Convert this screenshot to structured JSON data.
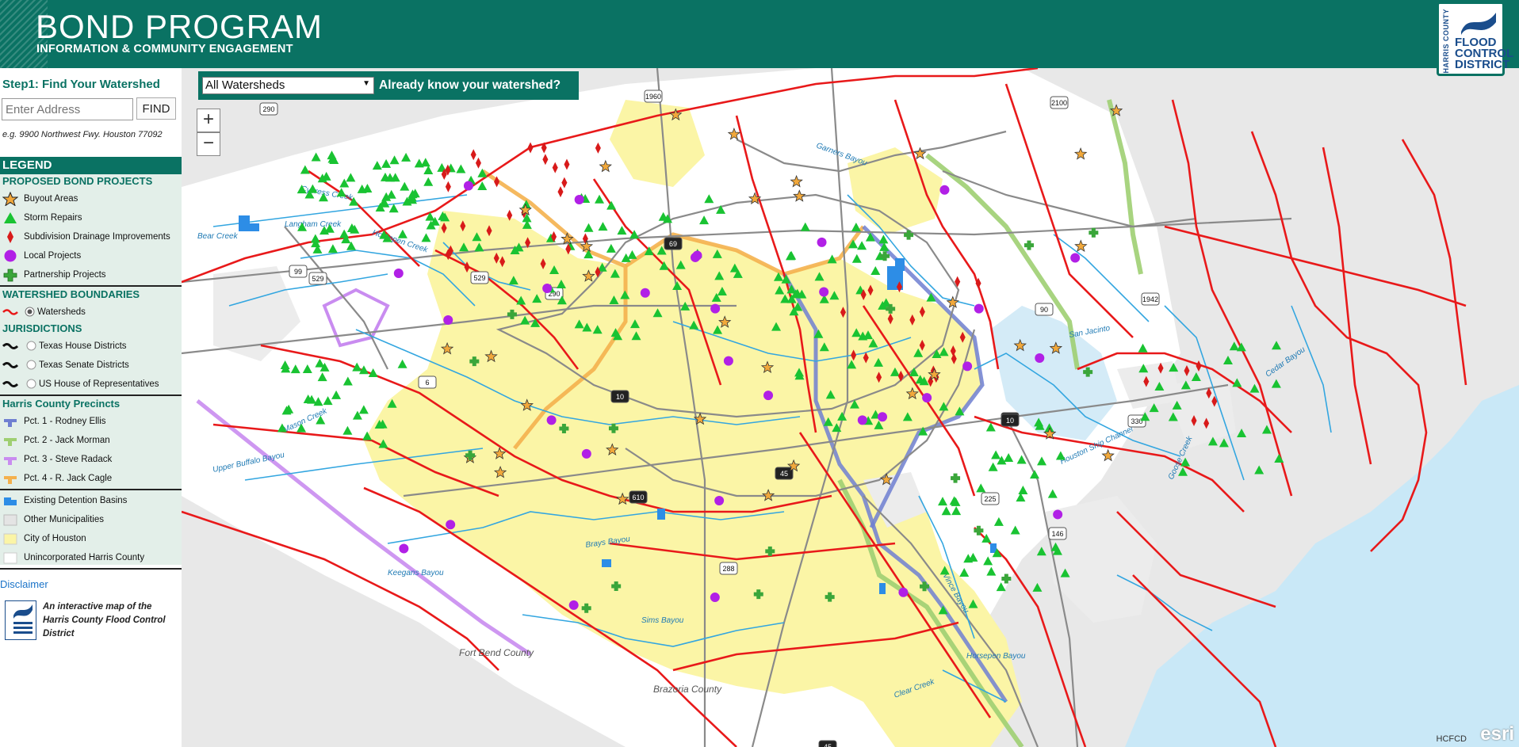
{
  "header": {
    "title": "BOND PROGRAM",
    "subtitle": "INFORMATION & COMMUNITY ENGAGEMENT",
    "logo_vertical": "HARRIS COUNTY",
    "logo_lines": [
      "FLOOD",
      "CONTROL",
      "DISTRICT"
    ]
  },
  "sidebar": {
    "step1_title": "Step1: Find Your Watershed",
    "address_placeholder": "Enter Address",
    "find_label": "FIND",
    "example": "e.g. 9900 Northwest Fwy. Houston 77092",
    "legend_title": "LEGEND",
    "sections": {
      "proposed": "PROPOSED BOND PROJECTS",
      "watershed": "WATERSHED BOUNDARIES",
      "jurisdictions": "JURISDICTIONS",
      "precincts": "Harris County Precincts"
    },
    "items": {
      "buyout": "Buyout Areas",
      "storm": "Storm Repairs",
      "subdivision": "Subdivision Drainage Improvements",
      "local": "Local Projects",
      "partnership": "Partnership Projects",
      "watersheds": "Watersheds",
      "tx_house": "Texas House Districts",
      "tx_senate": "Texas Senate Districts",
      "us_house": "US House of Representatives",
      "pct1": "Pct. 1 - Rodney Ellis",
      "pct2": "Pct. 2 - Jack Morman",
      "pct3": "Pct. 3 - Steve Radack",
      "pct4": "Pct. 4 - R. Jack Cagle",
      "detention": "Existing Detention Basins",
      "other_muni": "Other Municipalities",
      "city": "City of Houston",
      "unincorporated": "Unincorporated Harris County"
    },
    "disclaimer": "Disclaimer",
    "about": "An interactive map of the Harris County Flood Control District"
  },
  "map": {
    "watershed_select": "All Watersheds",
    "watershed_prompt": "Already know your watershed?",
    "zoom_in": "+",
    "zoom_out": "−",
    "attribution": "HCFCD",
    "esri": "esri",
    "labels": {
      "fort_bend": "Fort Bend County",
      "brazoria": "Brazoria County",
      "cypress": "Cypress Creek",
      "bear": "Bear Creek",
      "horsepen": "Horsepen Creek",
      "langham": "Langham Creek",
      "mason": "Mason Creek",
      "upper_buffalo": "Upper Buffalo Bayou",
      "keegans": "Keegans Bayou",
      "brays": "Brays Bayou",
      "sims": "Sims Bayou",
      "garners": "Garners Bayou",
      "cedar": "Cedar Bayou",
      "goose": "Goose Creek",
      "houston_ship": "Houston Ship Channel",
      "san_jacinto": "San Jacinto",
      "horsepen_bayou": "Horsepen Bayou",
      "clear": "Clear Creek",
      "vince": "Vince Bayou"
    },
    "shields": [
      "290",
      "1960",
      "2100",
      "99",
      "529",
      "529",
      "290",
      "6",
      "10",
      "10",
      "69",
      "610",
      "45",
      "288",
      "225",
      "146",
      "330",
      "90",
      "10",
      "1942",
      "45"
    ]
  },
  "colors": {
    "brand": "#0a7263",
    "city": "#fbf5a6",
    "water": "#c9e8f7",
    "watershed_line": "#e8191a",
    "storm": "#19c332",
    "subdivision": "#d81a1a",
    "local": "#b120e6",
    "partnership": "#3aa63a",
    "buyout": "#f1a83b",
    "pct1": "#6f7fd1",
    "pct2": "#9fcf72",
    "pct3": "#c98cf0",
    "pct4": "#f4b14e"
  }
}
